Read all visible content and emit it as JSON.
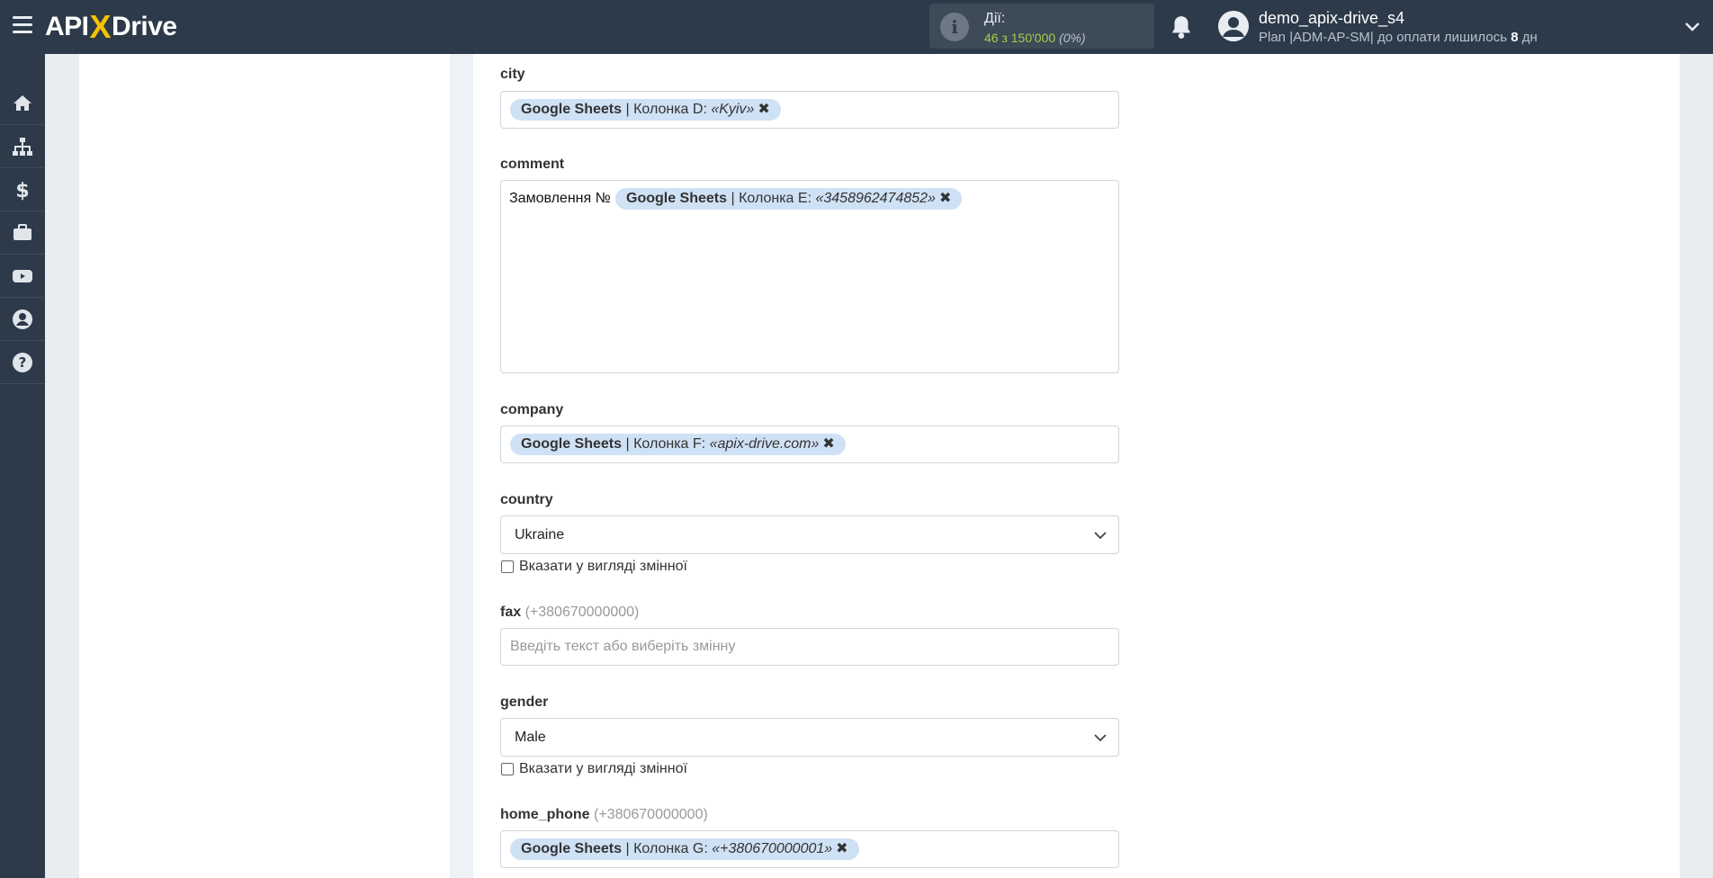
{
  "header": {
    "logo_left": "API",
    "logo_x": "X",
    "logo_right": "Drive",
    "actions_title": "Дії:",
    "actions_value": "46 з 150'000",
    "actions_percent": "(0%)",
    "user_name": "demo_apix-drive_s4",
    "user_plan_prefix": "Plan |ADM-AP-SM| до оплати лишилось",
    "user_plan_days": "8",
    "user_plan_suffix": "дн"
  },
  "sidebar": {
    "items": [
      "home-icon",
      "sitemap-icon",
      "dollar-icon",
      "briefcase-icon",
      "youtube-icon",
      "user-icon",
      "help-icon"
    ]
  },
  "form": {
    "city": {
      "label": "city",
      "chip_source": "Google Sheets",
      "chip_column": "| Колонка D:",
      "chip_value": "«Kyiv»",
      "chip_close": "✖"
    },
    "comment": {
      "label": "comment",
      "prefix_text": "Замовлення №",
      "chip_source": "Google Sheets",
      "chip_column": "| Колонка E:",
      "chip_value": "«3458962474852»",
      "chip_close": "✖"
    },
    "company": {
      "label": "company",
      "chip_source": "Google Sheets",
      "chip_column": "| Колонка F:",
      "chip_value": "«apix-drive.com»",
      "chip_close": "✖"
    },
    "country": {
      "label": "country",
      "selected": "Ukraine",
      "checkbox_label": "Вказати у вигляді змінної"
    },
    "fax": {
      "label": "fax",
      "hint": "(+380670000000)",
      "placeholder": "Введіть текст або виберіть змінну"
    },
    "gender": {
      "label": "gender",
      "selected": "Male",
      "checkbox_label": "Вказати у вигляді змінної"
    },
    "home_phone": {
      "label": "home_phone",
      "hint": "(+380670000000)",
      "chip_source": "Google Sheets",
      "chip_column": "| Колонка G:",
      "chip_value": "«+380670000001»",
      "chip_close": "✖"
    }
  },
  "colors": {
    "topbar": "#2c3a4a",
    "chip": "#cfe1f5",
    "actions_value": "#a7cc4a",
    "logo_accent": "#f5c400"
  }
}
